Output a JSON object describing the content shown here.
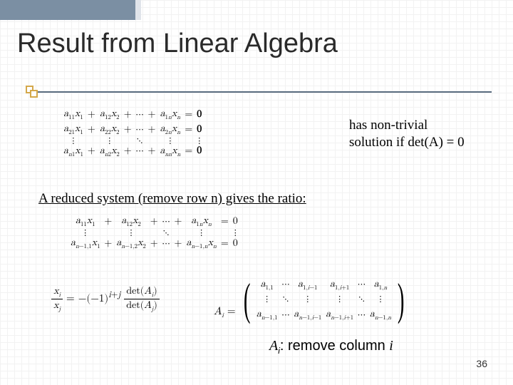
{
  "title": "Result from Linear Algebra",
  "note1_line1": "has non-trivial",
  "note1_line2": "solution if det(A) = 0",
  "subhead": "A reduced system (remove row n) gives the ratio:",
  "footer_prefix": "A",
  "footer_sub": "i",
  "footer_rest": ": remove column ",
  "footer_var": "i",
  "page_number": "36",
  "sys1": {
    "rows": [
      {
        "c": [
          "a",
          "11",
          "x",
          "1",
          "+",
          "a",
          "12",
          "x",
          "2",
          "+",
          "⋯",
          "+",
          "a",
          "1n",
          "x",
          "n",
          "=",
          "0"
        ]
      },
      {
        "c": [
          "a",
          "21",
          "x",
          "1",
          "+",
          "a",
          "22",
          "x",
          "2",
          "+",
          "⋯",
          "+",
          "a",
          "2n",
          "x",
          "n",
          "=",
          "0"
        ]
      },
      {
        "dots": true
      },
      {
        "c": [
          "a",
          "n1",
          "x",
          "1",
          "+",
          "a",
          "n2",
          "x",
          "2",
          "+",
          "⋯",
          "+",
          "a",
          "nn",
          "x",
          "n",
          "=",
          "0"
        ]
      }
    ]
  },
  "sys2": {
    "rows": [
      {
        "c": [
          "a",
          "11",
          "x",
          "1",
          "+",
          "a",
          "12",
          "x",
          "2",
          "+",
          "⋯",
          "+",
          "a",
          "1n",
          "x",
          "n",
          "=",
          "0"
        ]
      },
      {
        "dots": true
      },
      {
        "c": [
          "a",
          "n−1,1",
          "x",
          "1",
          "+",
          "a",
          "n−1,2",
          "x",
          "2",
          "+",
          "⋯",
          "+",
          "a",
          "n−1,n",
          "x",
          "n",
          "=",
          "0"
        ]
      }
    ]
  },
  "ratio": {
    "lhs_num": "xᵢ",
    "lhs_den": "xⱼ",
    "eq": " = ",
    "sign": "−(−1)",
    "exp": "i+j",
    "rhs_num": "det(Aᵢ)",
    "rhs_den": "det(Aⱼ)"
  },
  "Ai": {
    "label": "Aᵢ = ",
    "rows": [
      [
        "a₁,₁",
        "⋯",
        "a₁,ᵢ₋₁",
        "a₁,ᵢ₊₁",
        "⋯",
        "a₁,ₙ"
      ],
      [
        "⋮",
        "⋱",
        "⋮",
        "⋮",
        "⋱",
        "⋮"
      ],
      [
        "aₙ₋₁,₁",
        "⋯",
        "aₙ₋₁,ᵢ₋₁",
        "aₙ₋₁,ᵢ₊₁",
        "⋯",
        "aₙ₋₁,ₙ"
      ]
    ]
  }
}
